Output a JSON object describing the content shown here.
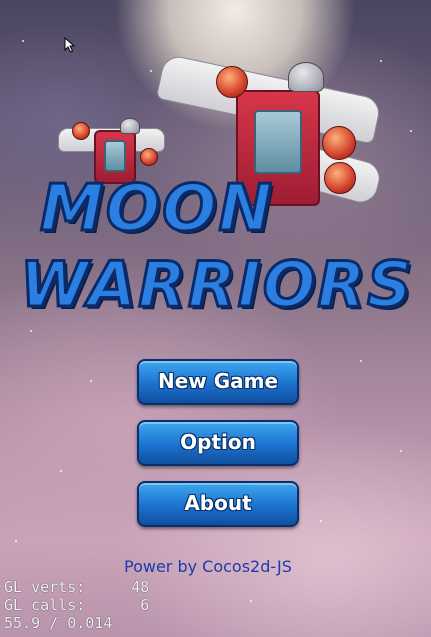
{
  "game": {
    "title_line1": "MOON",
    "title_line2": "WARRIORS"
  },
  "menu": {
    "items": [
      {
        "label": "New Game"
      },
      {
        "label": "Option"
      },
      {
        "label": "About"
      }
    ]
  },
  "footer": {
    "powered_by": "Power by Cocos2d-JS"
  },
  "debug": {
    "gl_verts_label": "GL verts:",
    "gl_verts_value": "48",
    "gl_calls_label": "GL calls:",
    "gl_calls_value": "6",
    "fps_line": "55.9 / 0.014"
  },
  "colors": {
    "button_blue": "#1c72cf",
    "title_blue": "#2b7fe0",
    "footer_text": "#1e3aa8"
  },
  "icons": [
    "mouse-cursor-icon",
    "player-ship-icon",
    "enemy-ship-icon"
  ]
}
